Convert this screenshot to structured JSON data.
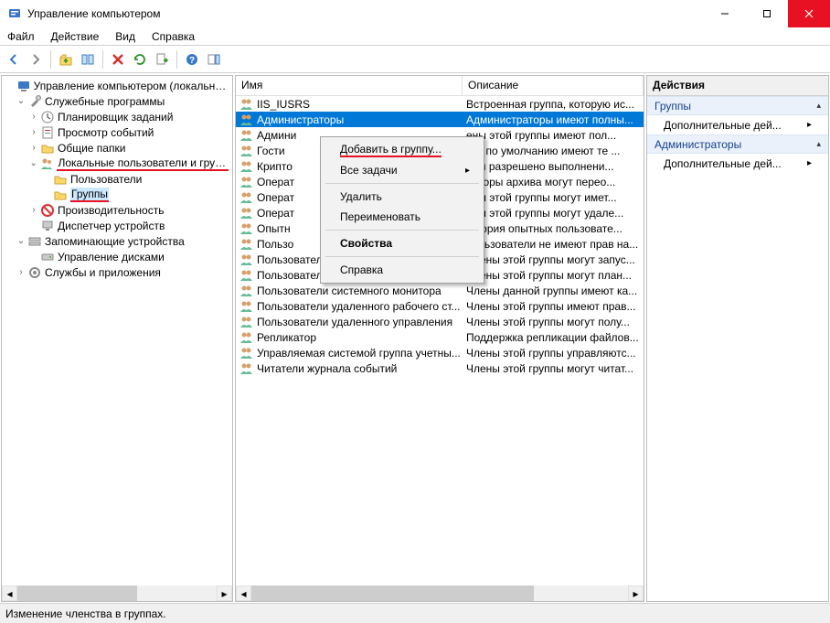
{
  "title": "Управление компьютером",
  "menu": {
    "file": "Файл",
    "action": "Действие",
    "view": "Вид",
    "help": "Справка"
  },
  "tree": {
    "root": "Управление компьютером (локальным)",
    "system_tools": "Служебные программы",
    "task_scheduler": "Планировщик заданий",
    "event_viewer": "Просмотр событий",
    "shared_folders": "Общие папки",
    "local_users": "Локальные пользователи и группы",
    "users": "Пользователи",
    "groups": "Группы",
    "performance": "Производительность",
    "device_manager": "Диспетчер устройств",
    "storage": "Запоминающие устройства",
    "disk_mgmt": "Управление дисками",
    "services": "Службы и приложения"
  },
  "list": {
    "col_name": "Имя",
    "col_desc": "Описание",
    "rows": [
      {
        "name": "IIS_IUSRS",
        "desc": "Встроенная группа, которую ис..."
      },
      {
        "name": "Администраторы",
        "desc": "Администраторы имеют полны...",
        "selected": true
      },
      {
        "name": "Админи",
        "desc": "ены этой группы имеют пол..."
      },
      {
        "name": "Гости",
        "desc": "сти по умолчанию имеют те ..."
      },
      {
        "name": "Крипто",
        "desc": "нам разрешено выполнени..."
      },
      {
        "name": "Операт",
        "desc": "раторы архива могут перео..."
      },
      {
        "name": "Операт",
        "desc": "ены этой группы могут имет..."
      },
      {
        "name": "Операт",
        "desc": "ены этой группы могут удале..."
      },
      {
        "name": "Опытн",
        "desc": "тегория опытных пользовате..."
      },
      {
        "name": "Пользо",
        "desc": "пользователи не имеют прав на..."
      },
      {
        "name": "Пользователи DCOM",
        "desc": "Члены этой группы могут запус..."
      },
      {
        "name": "Пользователи журналов производител...",
        "desc": "Члены этой группы могут план..."
      },
      {
        "name": "Пользователи системного монитора",
        "desc": "Члены данной группы имеют ка..."
      },
      {
        "name": "Пользователи удаленного рабочего ст...",
        "desc": "Члены этой группы имеют прав..."
      },
      {
        "name": "Пользователи удаленного управления",
        "desc": "Члены этой группы могут полу..."
      },
      {
        "name": "Репликатор",
        "desc": "Поддержка репликации файлов..."
      },
      {
        "name": "Управляемая системой группа учетны...",
        "desc": "Члены этой группы управляютс..."
      },
      {
        "name": "Читатели журнала событий",
        "desc": "Члены этой группы могут читат..."
      }
    ]
  },
  "context_menu": {
    "add_to_group": "Добавить в группу...",
    "all_tasks": "Все задачи",
    "delete": "Удалить",
    "rename": "Переименовать",
    "properties": "Свойства",
    "help": "Справка"
  },
  "actions": {
    "header": "Действия",
    "section1": "Группы",
    "more1": "Дополнительные дей...",
    "section2": "Администраторы",
    "more2": "Дополнительные дей..."
  },
  "status": "Изменение членства в группах."
}
